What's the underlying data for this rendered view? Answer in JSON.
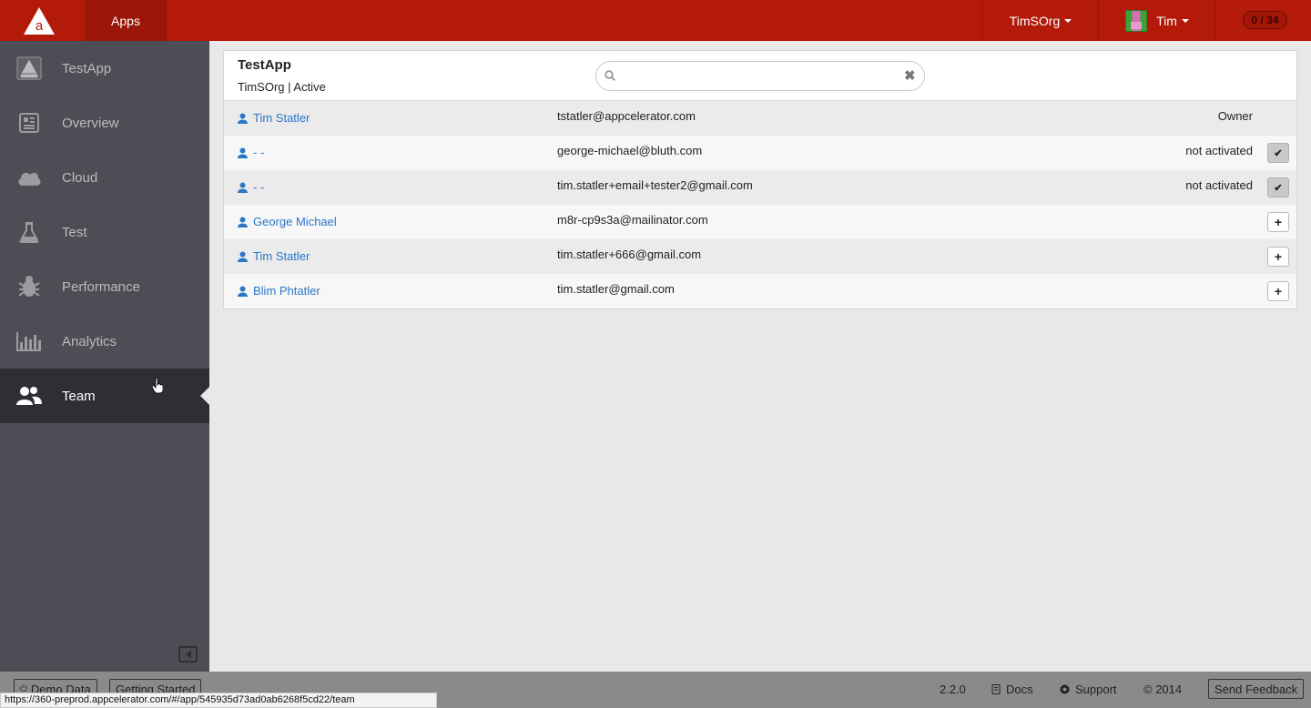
{
  "topbar": {
    "apps_label": "Apps",
    "org_label": "TimSOrg",
    "user_label": "Tim",
    "count_badge": "0 / 34"
  },
  "sidebar": {
    "items": [
      {
        "label": "TestApp",
        "icon": "alloy-app-icon"
      },
      {
        "label": "Overview",
        "icon": "newspaper-icon"
      },
      {
        "label": "Cloud",
        "icon": "cloud-icon"
      },
      {
        "label": "Test",
        "icon": "flask-icon"
      },
      {
        "label": "Performance",
        "icon": "bug-icon"
      },
      {
        "label": "Analytics",
        "icon": "bar-chart-icon"
      },
      {
        "label": "Team",
        "icon": "users-icon",
        "active": true
      }
    ]
  },
  "app": {
    "title": "TestApp",
    "subtitle": "TimSOrg | Active"
  },
  "search": {
    "value": "",
    "placeholder": ""
  },
  "team": {
    "rows": [
      {
        "name": "Tim Statler",
        "email": "tstatler@appcelerator.com",
        "status": "Owner",
        "action": "none"
      },
      {
        "name": "- -",
        "email": "george-michael@bluth.com",
        "status": "not activated",
        "action": "check"
      },
      {
        "name": "- -",
        "email": "tim.statler+email+tester2@gmail.com",
        "status": "not activated",
        "action": "check"
      },
      {
        "name": "George Michael",
        "email": "m8r-cp9s3a@mailinator.com",
        "status": "",
        "action": "plus"
      },
      {
        "name": "Tim Statler",
        "email": "tim.statler+666@gmail.com",
        "status": "",
        "action": "plus"
      },
      {
        "name": "Blim Phtatler",
        "email": "tim.statler@gmail.com",
        "status": "",
        "action": "plus"
      }
    ]
  },
  "footer": {
    "demo_data": "Demo Data",
    "getting_started": "Getting Started",
    "version": "2.2.0",
    "docs": "Docs",
    "support": "Support",
    "copyright": "© 2014",
    "send_feedback": "Send Feedback"
  },
  "status_url": "https://360-preprod.appcelerator.com/#/app/545935d73ad0ab6268f5cd22/team",
  "colors": {
    "brand_red": "#b31a0a",
    "sidebar_bg": "#4d4e55",
    "sidebar_active": "#2e2f34",
    "link_blue": "#2b77c6"
  }
}
